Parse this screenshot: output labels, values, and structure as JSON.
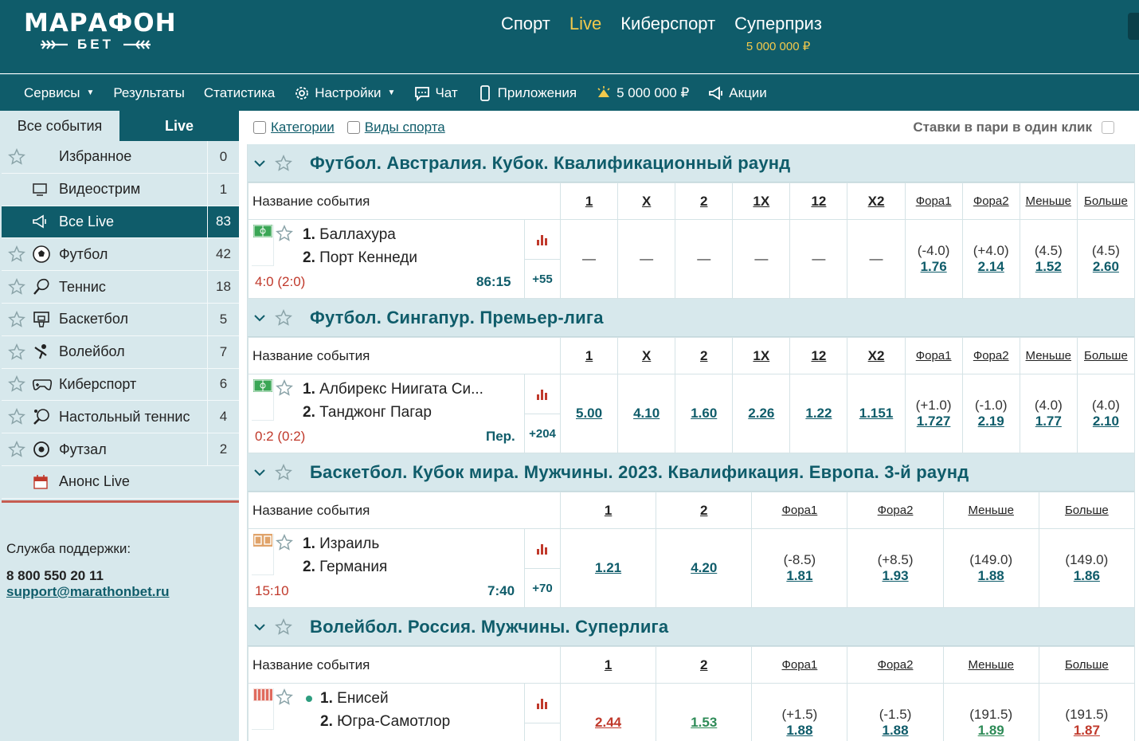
{
  "header": {
    "logo_main": "МАРАФОН",
    "logo_sub": "БЕТ",
    "nav": [
      {
        "label": "Спорт"
      },
      {
        "label": "Live"
      },
      {
        "label": "Киберспорт"
      },
      {
        "label": "Суперприз",
        "amount": "5 000 000 ₽"
      }
    ]
  },
  "subnav": [
    {
      "label": "Сервисы",
      "icon": "none"
    },
    {
      "label": "Результаты",
      "icon": "none"
    },
    {
      "label": "Статистика",
      "icon": "none"
    },
    {
      "label": "Настройки",
      "icon": "gear-icon"
    },
    {
      "label": "Чат",
      "icon": "chat-icon"
    },
    {
      "label": "Приложения",
      "icon": "phone-icon"
    },
    {
      "label": "5 000 000 ₽",
      "icon": "prize-icon"
    },
    {
      "label": "Акции",
      "icon": "megaphone-icon"
    }
  ],
  "sidebar": {
    "tabs": [
      "Все события",
      "Live"
    ],
    "items": [
      {
        "label": "Избранное",
        "count": "0"
      },
      {
        "label": "Видеострим",
        "count": "1"
      },
      {
        "label": "Все Live",
        "count": "83"
      },
      {
        "label": "Футбол",
        "count": "42"
      },
      {
        "label": "Теннис",
        "count": "18"
      },
      {
        "label": "Баскетбол",
        "count": "5"
      },
      {
        "label": "Волейбол",
        "count": "7"
      },
      {
        "label": "Киберспорт",
        "count": "6"
      },
      {
        "label": "Настольный теннис",
        "count": "4"
      },
      {
        "label": "Футзал",
        "count": "2"
      },
      {
        "label": "Анонс Live",
        "count": ""
      }
    ],
    "support_label": "Служба поддержки:",
    "support_phone": "8 800 550 20 11",
    "support_email": "support@marathonbet.ru"
  },
  "filters": {
    "categories": "Категории",
    "sports": "Виды спорта",
    "one_click": "Ставки в пари в один клик"
  },
  "colors": {
    "brand": "#0f5c6a",
    "accent": "#f2c94c",
    "score": "#c0392b"
  },
  "events": [
    {
      "title": "Футбол. Австралия. Кубок. Квалификационный раунд",
      "name_header": "Название события",
      "cols": [
        "1",
        "X",
        "2",
        "1X",
        "12",
        "X2",
        "Фора1",
        "Фора2",
        "Меньше",
        "Больше"
      ],
      "team1": "Баллахура",
      "team2": "Порт Кеннеди",
      "score": "4:0 (2:0)",
      "time": "86:15",
      "more": "+55",
      "odds": [
        {
          "p": "",
          "v": "—"
        },
        {
          "p": "",
          "v": "—"
        },
        {
          "p": "",
          "v": "—"
        },
        {
          "p": "",
          "v": "—"
        },
        {
          "p": "",
          "v": "—"
        },
        {
          "p": "",
          "v": "—"
        },
        {
          "p": "(-4.0)",
          "v": "1.76"
        },
        {
          "p": "(+4.0)",
          "v": "2.14"
        },
        {
          "p": "(4.5)",
          "v": "1.52"
        },
        {
          "p": "(4.5)",
          "v": "2.60"
        }
      ]
    },
    {
      "title": "Футбол. Сингапур. Премьер-лига",
      "name_header": "Название события",
      "cols": [
        "1",
        "X",
        "2",
        "1X",
        "12",
        "X2",
        "Фора1",
        "Фора2",
        "Меньше",
        "Больше"
      ],
      "team1": "Албирекс Ниигата Си...",
      "team2": "Танджонг Пагар",
      "score": "0:2 (0:2)",
      "time": "Пер.",
      "more": "+204",
      "odds": [
        {
          "p": "",
          "v": "5.00"
        },
        {
          "p": "",
          "v": "4.10"
        },
        {
          "p": "",
          "v": "1.60"
        },
        {
          "p": "",
          "v": "2.26"
        },
        {
          "p": "",
          "v": "1.22"
        },
        {
          "p": "",
          "v": "1.151"
        },
        {
          "p": "(+1.0)",
          "v": "1.727"
        },
        {
          "p": "(-1.0)",
          "v": "2.19"
        },
        {
          "p": "(4.0)",
          "v": "1.77"
        },
        {
          "p": "(4.0)",
          "v": "2.10"
        }
      ]
    },
    {
      "title": "Баскетбол. Кубок мира. Мужчины. 2023. Квалификация. Европа. 3-й раунд",
      "name_header": "Название события",
      "cols": [
        "1",
        "2",
        "Фора1",
        "Фора2",
        "Меньше",
        "Больше"
      ],
      "team1": "Израиль",
      "team2": "Германия",
      "score": "15:10",
      "time": "7:40",
      "more": "+70",
      "odds": [
        {
          "p": "",
          "v": "1.21"
        },
        {
          "p": "",
          "v": "4.20"
        },
        {
          "p": "(-8.5)",
          "v": "1.81"
        },
        {
          "p": "(+8.5)",
          "v": "1.93"
        },
        {
          "p": "(149.0)",
          "v": "1.88"
        },
        {
          "p": "(149.0)",
          "v": "1.86"
        }
      ]
    },
    {
      "title": "Волейбол. Россия. Мужчины. Суперлига",
      "name_header": "Название события",
      "cols": [
        "1",
        "2",
        "Фора1",
        "Фора2",
        "Меньше",
        "Больше"
      ],
      "team1": "Енисей",
      "team2": "Югра-Самотлор",
      "score": "",
      "time": "",
      "more": "",
      "odds": [
        {
          "p": "",
          "v": "2.44",
          "trend": "down"
        },
        {
          "p": "",
          "v": "1.53",
          "trend": "up"
        },
        {
          "p": "(+1.5)",
          "v": "1.88"
        },
        {
          "p": "(-1.5)",
          "v": "1.88"
        },
        {
          "p": "(191.5)",
          "v": "1.89",
          "trend": "up"
        },
        {
          "p": "(191.5)",
          "v": "1.87",
          "trend": "down"
        }
      ]
    }
  ]
}
